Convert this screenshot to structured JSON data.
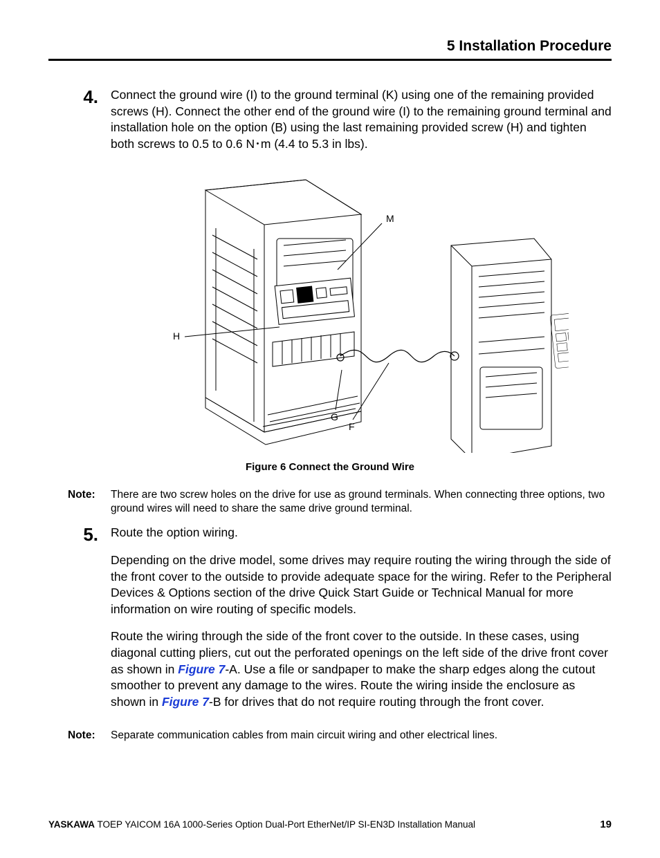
{
  "header": {
    "chapter": "5  Installation Procedure"
  },
  "steps": {
    "s4": {
      "num": "4.",
      "text": "Connect the ground wire (I) to the ground terminal (K) using one of the remaining provided screws (H). Connect the other end of the ground wire (I) to the remaining ground terminal and installation hole on the option (B) using the last remaining provided screw (H) and tighten both screws to 0.5 to 0.6 N･m (4.4 to 5.3 in lbs)."
    },
    "s5": {
      "num": "5.",
      "intro": "Route the option wiring.",
      "p1": "Depending on the drive model, some drives may require routing the wiring through the side of the front cover to the outside to provide adequate space for the wiring. Refer to the Peripheral Devices & Options section of the drive Quick Start Guide or Technical Manual for more information on wire routing of specific models.",
      "p2a": "Route the wiring through the side of the front cover to the outside. In these cases, using diagonal cutting pliers, cut out the perforated openings on the left side of the drive front cover as shown in ",
      "link1": "Figure 7",
      "p2b": "-A. Use a file or sandpaper to make the sharp edges along the cutout smoother to prevent any damage to the wires. Route the wiring inside the enclosure as shown in ",
      "link2": "Figure 7",
      "p2c": "-B for drives that do not require routing through the front cover."
    }
  },
  "figure": {
    "caption": "Figure 6   Connect the Ground Wire",
    "labels": {
      "M": "M",
      "H": "H",
      "G": "G",
      "F": "F"
    }
  },
  "notes": {
    "label": "Note:",
    "n1": "There are two screw holes on the drive for use as ground terminals. When connecting three options, two ground wires will need to share the same drive ground terminal.",
    "n2": "Separate communication cables from main circuit wiring and other electrical lines."
  },
  "footer": {
    "brand": "YASKAWA",
    "doc": " TOEP YAICOM 16A 1000-Series Option Dual-Port EtherNet/IP SI-EN3D Installation Manual",
    "page": "19"
  }
}
